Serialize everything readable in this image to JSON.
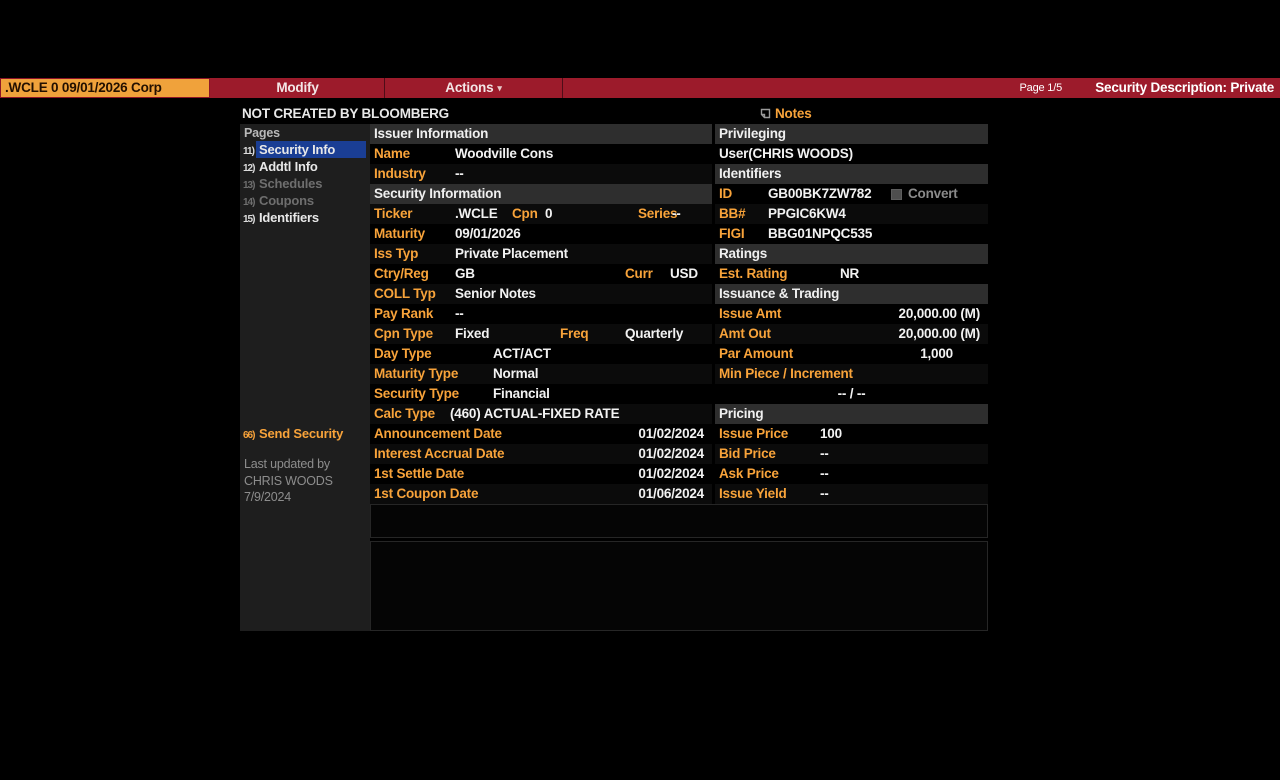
{
  "colors": {
    "bar_red": "#9c1b2b",
    "ticker_bg": "#f0a23b",
    "accent_orange": "#f8a33a",
    "selected_blue": "#1a3e94",
    "section_header_bg": "#2e2e2e"
  },
  "topbar": {
    "ticker": ".WCLE 0 09/01/2026 Corp",
    "modify": "Modify",
    "actions": "Actions",
    "page": "Page 1/5",
    "title": "Security Description: Private"
  },
  "banner": {
    "not_created": "NOT CREATED BY BLOOMBERG",
    "notes": "Notes"
  },
  "sidebar": {
    "header": "Pages",
    "items": [
      {
        "num": "11)",
        "label": "Security Info",
        "state": "selected"
      },
      {
        "num": "12)",
        "label": "Addtl Info",
        "state": "normal"
      },
      {
        "num": "13)",
        "label": "Schedules",
        "state": "disabled"
      },
      {
        "num": "14)",
        "label": "Coupons",
        "state": "disabled"
      },
      {
        "num": "15)",
        "label": "Identifiers",
        "state": "normal"
      }
    ],
    "send": {
      "num": "66)",
      "label": "Send Security"
    },
    "updated": [
      "Last updated by",
      "CHRIS WOODS",
      "7/9/2024"
    ]
  },
  "issuer": {
    "header": "Issuer Information",
    "name_label": "Name",
    "name_value": "Woodville Cons",
    "industry_label": "Industry",
    "industry_value": "--"
  },
  "security": {
    "header": "Security Information",
    "ticker_label": "Ticker",
    "ticker_value": ".WCLE",
    "cpn_label": "Cpn",
    "cpn_value": "0",
    "series_label": "Series",
    "series_value": "--",
    "maturity_label": "Maturity",
    "maturity_value": "09/01/2026",
    "iss_typ_label": "Iss Typ",
    "iss_typ_value": "Private Placement",
    "ctry_label": "Ctry/Reg",
    "ctry_value": "GB",
    "curr_label": "Curr",
    "curr_value": "USD",
    "coll_label": "COLL Typ",
    "coll_value": "Senior Notes",
    "pay_rank_label": "Pay Rank",
    "pay_rank_value": "--",
    "cpn_type_label": "Cpn Type",
    "cpn_type_value": "Fixed",
    "freq_label": "Freq",
    "freq_value": "Quarterly",
    "day_type_label": "Day Type",
    "day_type_value": "ACT/ACT",
    "maturity_type_label": "Maturity Type",
    "maturity_type_value": "Normal",
    "security_type_label": "Security Type",
    "security_type_value": "Financial",
    "calc_type_label": "Calc Type",
    "calc_type_value": "(460) ACTUAL-FIXED RATE"
  },
  "dates": {
    "rows": [
      {
        "label": "Announcement Date",
        "value": "01/02/2024"
      },
      {
        "label": "Interest Accrual Date",
        "value": "01/02/2024"
      },
      {
        "label": "1st Settle Date",
        "value": "01/02/2024"
      },
      {
        "label": "1st Coupon Date",
        "value": "01/06/2024"
      }
    ]
  },
  "privileging": {
    "header": "Privileging",
    "user": "User(CHRIS WOODS)"
  },
  "identifiers": {
    "header": "Identifiers",
    "id_label": "ID",
    "id_value": "GB00BK7ZW782",
    "convert_label": "Convert",
    "bb_label": "BB#",
    "bb_value": "PPGIC6KW4",
    "figi_label": "FIGI",
    "figi_value": "BBG01NPQC535"
  },
  "ratings": {
    "header": "Ratings",
    "est_label": "Est. Rating",
    "est_value": "NR"
  },
  "issuance": {
    "header": "Issuance & Trading",
    "issue_amt_label": "Issue Amt",
    "issue_amt_value": "20,000.00 (M)",
    "amt_out_label": "Amt Out",
    "amt_out_value": "20,000.00 (M)",
    "par_label": "Par Amount",
    "par_value": "1,000",
    "min_label": "Min Piece / Increment",
    "min_value": "-- / --"
  },
  "pricing": {
    "header": "Pricing",
    "rows": [
      {
        "label": "Issue Price",
        "value": "100"
      },
      {
        "label": "Bid Price",
        "value": "--"
      },
      {
        "label": "Ask Price",
        "value": "--"
      },
      {
        "label": "Issue Yield",
        "value": "--"
      }
    ]
  }
}
